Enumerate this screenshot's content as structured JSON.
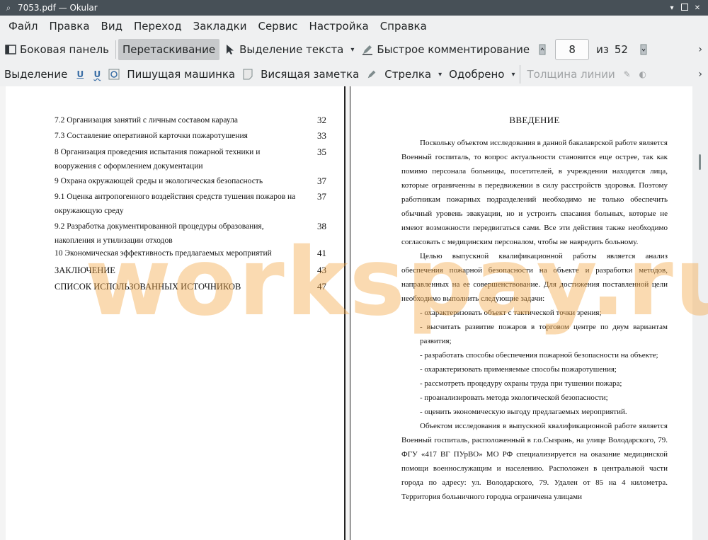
{
  "window": {
    "title": "7053.pdf  — Okular"
  },
  "menu": [
    "Файл",
    "Правка",
    "Вид",
    "Переход",
    "Закладки",
    "Сервис",
    "Настройка",
    "Справка"
  ],
  "toolbar1": {
    "sidebar": "Боковая панель",
    "browse": "Перетаскивание",
    "text_select": "Выделение текста",
    "quick_annot": "Быстрое комментирование",
    "page_current": "8",
    "page_of": "из",
    "page_total": "52"
  },
  "toolbar2": {
    "selection": "Выделение",
    "typewriter": "Пишущая машинка",
    "popup_note": "Висящая заметка",
    "arrow": "Стрелка",
    "approved": "Одобрено",
    "line_width": "Толщина линии"
  },
  "toc": [
    {
      "text": "7.2 Организация занятий с личным составом караула",
      "page": "32"
    },
    {
      "text": "7.3 Составление оперативной карточки пожаротушения",
      "page": "33"
    },
    {
      "text": "8 Организация проведения испытания пожарной техники и вооружения с оформлением документации",
      "page": "35"
    },
    {
      "text": "9 Охрана окружающей среды и экологическая безопасность",
      "page": "37"
    },
    {
      "text": "9.1 Оценка антропогенного воздействия средств тушения пожаров на окружающую среду",
      "page": "37"
    },
    {
      "text": "9.2 Разработка документированной процедуры образования, накопления и утилизации отходов",
      "page": "38"
    },
    {
      "text": "10 Экономическая эффективность предлагаемых мероприятий",
      "page": "41"
    },
    {
      "text": "ЗАКЛЮЧЕНИЕ",
      "page": "43"
    },
    {
      "text": "СПИСОК ИСПОЛЬЗОВАННЫХ ИСТОЧНИКОВ",
      "page": "47"
    }
  ],
  "intro": {
    "heading": "ВВЕДЕНИЕ",
    "p1": "Поскольку объектом исследования в данной бакалаврской работе является Военный госпиталь, то вопрос актуальности становится еще острее, так как помимо персонала больницы, посетителей, в учреждении находятся лица, которые ограниченны в передвижении в силу расстройств здоровья. Поэтому работникам пожарных подразделений необходимо не только обеспечить обычный уровень эвакуации, но и устроить спасания больных, которые не имеют возможности передвигаться сами. Все эти действия также необходимо согласовать с медицинским персоналом, чтобы не навредить больному.",
    "p2": "Целью выпускной квалификационной работы является анализ обеспечения пожарной безопасности на объекте и разработки методов, направленных на ее совершенствование. Для достижения поставленной цели необходимо выполнить следующие задачи:",
    "tasks": [
      "- охарактеризовать объект с тактической точки зрения;",
      "- высчитать развитие пожаров в торговом центре по двум вариантам развития;",
      "- разработать способы обеспечения пожарной безопасности на объекте;",
      "- охарактеризовать применяемые способы пожаротушения;",
      "- рассмотреть процедуру охраны труда при тушении пожара;",
      "- проанализировать метода экологической безопасности;",
      "- оценить экономическую выгоду предлагаемых мероприятий."
    ],
    "p3": "Объектом исследования в выпускной квалификационной работе является Военный госпиталь, расположенный в г.о.Сызрань, на улице Володарского, 79. ФГУ «417 ВГ ПУрВО» МО РФ специализируется на оказание медицинской помощи военнослужащим и населению. Расположен в центральной части города по адресу: ул. Володарского, 79. Удален от 85 на 4 километра. Территория больничного городка ограничена улицами"
  },
  "watermark": "workspay.ru"
}
